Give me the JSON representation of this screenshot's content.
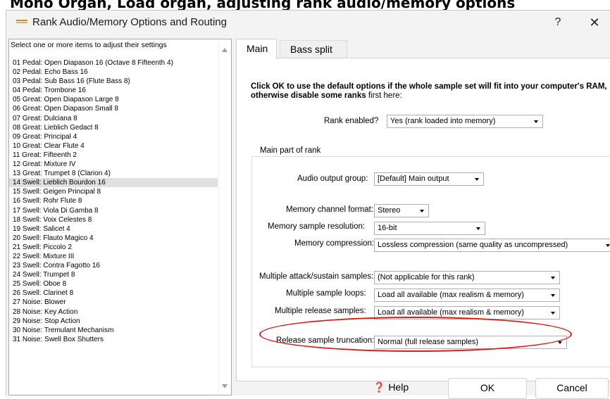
{
  "caption": "Mono Organ, Load organ, adjusting rank audio/memory options",
  "window": {
    "title": "Rank Audio/Memory Options and Routing",
    "help_glyph": "?",
    "close_glyph": "✕"
  },
  "list": {
    "prompt": "Select one or more items to adjust their settings",
    "items": [
      "01 Pedal: Open Diapason 16 (Octave 8 Fifteenth 4)",
      "02 Pedal: Echo Bass 16",
      "03 Pedal: Sub Bass 16 (Flute Bass 8)",
      "04 Pedal: Trombone 16",
      "05 Great: Open Diapason Large 8",
      "06 Great: Open Diapason Small 8",
      "07 Great: Dulciana 8",
      "08 Great: Lieblich Gedact 8",
      "09 Great: Principal 4",
      "10 Great: Clear Flute 4",
      "11 Great: Fifteenth 2",
      "12 Great: Mixture IV",
      "13 Great: Trumpet 8 (Clarion 4)",
      "14 Swell: Lieblich Bourdon 16",
      "15 Swell: Geigen Principal 8",
      "16 Swell: Rohr Flute 8",
      "17 Swell: Viola Di Gamba 8",
      "18 Swell: Voix Celestes 8",
      "19 Swell: Salicet 4",
      "20 Swell: Flauto Magico 4",
      "21 Swell: Piccolo 2",
      "22 Swell: Mixture III",
      "23 Swell: Contra Fagotto 16",
      "24 Swell: Trumpet 8",
      "25 Swell: Oboe 8",
      "26 Swell: Clarinet 8",
      "27 Noise: Blower",
      "28 Noise: Key Action",
      "29 Noise: Stop Action",
      "30 Noise: Tremulant Mechanism",
      "31 Noise: Swell Box Shutters"
    ],
    "selected_index": 13
  },
  "tabs": {
    "main": "Main",
    "bass_split": "Bass split"
  },
  "main": {
    "intro_bold_1": "Click OK to use the default options if the whole sample set will fit into your computer's RAM,",
    "intro_bold_2": "otherwise disable some ranks",
    "intro_normal": " first here:",
    "rank_enabled_label": "Rank enabled?",
    "rank_enabled_value": "Yes (rank loaded into memory)",
    "group_title": "Main part of rank",
    "audio_output_label": "Audio output group:",
    "audio_output_value": "[Default] Main output",
    "channel_format_label": "Memory channel format:",
    "channel_format_value": "Stereo",
    "sample_resolution_label": "Memory sample resolution:",
    "sample_resolution_value": "16-bit",
    "compression_label": "Memory compression:",
    "compression_value": "Lossless compression (same quality as uncompressed)",
    "attack_sustain_label": "Multiple attack/sustain samples:",
    "attack_sustain_value": "(Not applicable for this rank)",
    "sample_loops_label": "Multiple sample loops:",
    "sample_loops_value": "Load all available (max realism & memory)",
    "release_samples_label": "Multiple release samples:",
    "release_samples_value": "Load all available (max realism & memory)",
    "release_truncation_label": "Release sample truncation:",
    "release_truncation_value": "Normal (full release samples)"
  },
  "buttons": {
    "help": "Help",
    "help_glyph": "❓",
    "ok": "OK",
    "cancel": "Cancel"
  },
  "colors": {
    "highlight_ellipse": "#e01818",
    "selected_row": "#e0e0e0"
  }
}
